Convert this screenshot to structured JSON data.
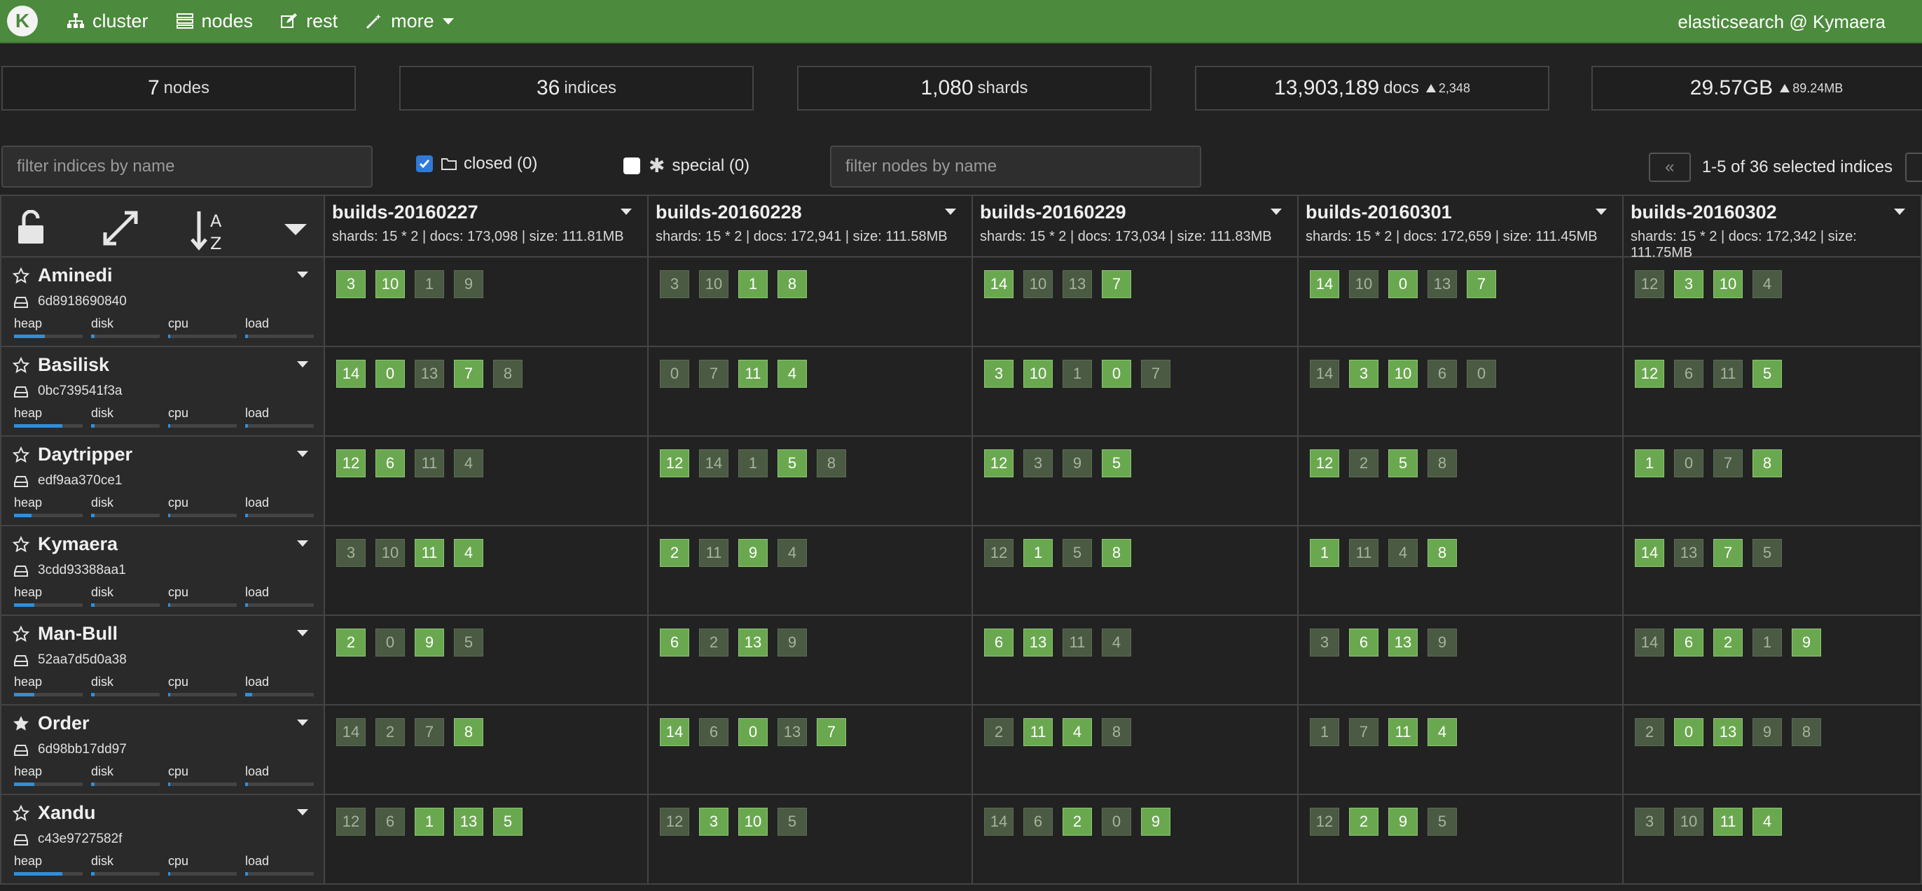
{
  "nav": {
    "logo": "K",
    "items": [
      {
        "label": "cluster",
        "icon": "sitemap-icon"
      },
      {
        "label": "nodes",
        "icon": "server-icon"
      },
      {
        "label": "rest",
        "icon": "edit-icon"
      },
      {
        "label": "more",
        "icon": "magic-icon"
      }
    ],
    "cluster_name": "elasticsearch @ Kymaera"
  },
  "stats": {
    "nodes": {
      "value": "7",
      "unit": "nodes"
    },
    "indices": {
      "value": "36",
      "unit": "indices"
    },
    "shards": {
      "value": "1,080",
      "unit": "shards"
    },
    "docs": {
      "value": "13,903,189",
      "unit": "docs",
      "delta": "2,348"
    },
    "size": {
      "value": "29.57GB",
      "delta": "89.24MB"
    }
  },
  "filters": {
    "indices_placeholder": "filter indices by name",
    "closed_label": "closed (0)",
    "special_label": "special (0)",
    "nodes_placeholder": "filter nodes by name",
    "pager_prev": "«",
    "pager_text": "1-5 of 36 selected indices"
  },
  "metric_labels": {
    "heap": "heap",
    "disk": "disk",
    "cpu": "cpu",
    "load": "load"
  },
  "indices": [
    {
      "name": "builds-20160227",
      "meta": "shards: 15 * 2 | docs: 173,098 | size: 111.81MB"
    },
    {
      "name": "builds-20160228",
      "meta": "shards: 15 * 2 | docs: 172,941 | size: 111.58MB"
    },
    {
      "name": "builds-20160229",
      "meta": "shards: 15 * 2 | docs: 173,034 | size: 111.83MB"
    },
    {
      "name": "builds-20160301",
      "meta": "shards: 15 * 2 | docs: 172,659 | size: 111.45MB"
    },
    {
      "name": "builds-20160302",
      "meta": "shards: 15 * 2 | docs: 172,342 | size: 111.75MB"
    }
  ],
  "nodes": [
    {
      "name": "Aminedi",
      "id": "6d8918690840",
      "master": false,
      "heap": 0.45,
      "disk": 0.05,
      "cpu": 0.03,
      "load": 0.04,
      "shards": [
        [
          {
            "n": "3",
            "p": true
          },
          {
            "n": "10",
            "p": true
          },
          {
            "n": "1",
            "p": false
          },
          {
            "n": "9",
            "p": false
          }
        ],
        [
          {
            "n": "3",
            "p": false
          },
          {
            "n": "10",
            "p": false
          },
          {
            "n": "1",
            "p": true
          },
          {
            "n": "8",
            "p": true
          }
        ],
        [
          {
            "n": "14",
            "p": true
          },
          {
            "n": "10",
            "p": false
          },
          {
            "n": "13",
            "p": false
          },
          {
            "n": "7",
            "p": true
          }
        ],
        [
          {
            "n": "14",
            "p": true
          },
          {
            "n": "10",
            "p": false
          },
          {
            "n": "0",
            "p": true
          },
          {
            "n": "13",
            "p": false
          },
          {
            "n": "7",
            "p": true
          }
        ],
        [
          {
            "n": "12",
            "p": false
          },
          {
            "n": "3",
            "p": true
          },
          {
            "n": "10",
            "p": true
          },
          {
            "n": "4",
            "p": false
          }
        ]
      ]
    },
    {
      "name": "Basilisk",
      "id": "0bc739541f3a",
      "master": false,
      "heap": 0.7,
      "disk": 0.05,
      "cpu": 0.03,
      "load": 0.04,
      "shards": [
        [
          {
            "n": "14",
            "p": true
          },
          {
            "n": "0",
            "p": true
          },
          {
            "n": "13",
            "p": false
          },
          {
            "n": "7",
            "p": true
          },
          {
            "n": "8",
            "p": false
          }
        ],
        [
          {
            "n": "0",
            "p": false
          },
          {
            "n": "7",
            "p": false
          },
          {
            "n": "11",
            "p": true
          },
          {
            "n": "4",
            "p": true
          }
        ],
        [
          {
            "n": "3",
            "p": true
          },
          {
            "n": "10",
            "p": true
          },
          {
            "n": "1",
            "p": false
          },
          {
            "n": "0",
            "p": true
          },
          {
            "n": "7",
            "p": false
          }
        ],
        [
          {
            "n": "14",
            "p": false
          },
          {
            "n": "3",
            "p": true
          },
          {
            "n": "10",
            "p": true
          },
          {
            "n": "6",
            "p": false
          },
          {
            "n": "0",
            "p": false
          }
        ],
        [
          {
            "n": "12",
            "p": true
          },
          {
            "n": "6",
            "p": false
          },
          {
            "n": "11",
            "p": false
          },
          {
            "n": "5",
            "p": true
          }
        ]
      ]
    },
    {
      "name": "Daytripper",
      "id": "edf9aa370ce1",
      "master": false,
      "heap": 0.25,
      "disk": 0.05,
      "cpu": 0.03,
      "load": 0.04,
      "shards": [
        [
          {
            "n": "12",
            "p": true
          },
          {
            "n": "6",
            "p": true
          },
          {
            "n": "11",
            "p": false
          },
          {
            "n": "4",
            "p": false
          }
        ],
        [
          {
            "n": "12",
            "p": true
          },
          {
            "n": "14",
            "p": false
          },
          {
            "n": "1",
            "p": false
          },
          {
            "n": "5",
            "p": true
          },
          {
            "n": "8",
            "p": false
          }
        ],
        [
          {
            "n": "12",
            "p": true
          },
          {
            "n": "3",
            "p": false
          },
          {
            "n": "9",
            "p": false
          },
          {
            "n": "5",
            "p": true
          }
        ],
        [
          {
            "n": "12",
            "p": true
          },
          {
            "n": "2",
            "p": false
          },
          {
            "n": "5",
            "p": true
          },
          {
            "n": "8",
            "p": false
          }
        ],
        [
          {
            "n": "1",
            "p": true
          },
          {
            "n": "0",
            "p": false
          },
          {
            "n": "7",
            "p": false
          },
          {
            "n": "8",
            "p": true
          }
        ]
      ]
    },
    {
      "name": "Kymaera",
      "id": "3cdd93388aa1",
      "master": false,
      "heap": 0.3,
      "disk": 0.05,
      "cpu": 0.03,
      "load": 0.04,
      "shards": [
        [
          {
            "n": "3",
            "p": false
          },
          {
            "n": "10",
            "p": false
          },
          {
            "n": "11",
            "p": true
          },
          {
            "n": "4",
            "p": true
          }
        ],
        [
          {
            "n": "2",
            "p": true
          },
          {
            "n": "11",
            "p": false
          },
          {
            "n": "9",
            "p": true
          },
          {
            "n": "4",
            "p": false
          }
        ],
        [
          {
            "n": "12",
            "p": false
          },
          {
            "n": "1",
            "p": true
          },
          {
            "n": "5",
            "p": false
          },
          {
            "n": "8",
            "p": true
          }
        ],
        [
          {
            "n": "1",
            "p": true
          },
          {
            "n": "11",
            "p": false
          },
          {
            "n": "4",
            "p": false
          },
          {
            "n": "8",
            "p": true
          }
        ],
        [
          {
            "n": "14",
            "p": true
          },
          {
            "n": "13",
            "p": false
          },
          {
            "n": "7",
            "p": true
          },
          {
            "n": "5",
            "p": false
          }
        ]
      ]
    },
    {
      "name": "Man-Bull",
      "id": "52aa7d5d0a38",
      "master": false,
      "heap": 0.3,
      "disk": 0.05,
      "cpu": 0.03,
      "load": 0.1,
      "shards": [
        [
          {
            "n": "2",
            "p": true
          },
          {
            "n": "0",
            "p": false
          },
          {
            "n": "9",
            "p": true
          },
          {
            "n": "5",
            "p": false
          }
        ],
        [
          {
            "n": "6",
            "p": true
          },
          {
            "n": "2",
            "p": false
          },
          {
            "n": "13",
            "p": true
          },
          {
            "n": "9",
            "p": false
          }
        ],
        [
          {
            "n": "6",
            "p": true
          },
          {
            "n": "13",
            "p": true
          },
          {
            "n": "11",
            "p": false
          },
          {
            "n": "4",
            "p": false
          }
        ],
        [
          {
            "n": "3",
            "p": false
          },
          {
            "n": "6",
            "p": true
          },
          {
            "n": "13",
            "p": true
          },
          {
            "n": "9",
            "p": false
          }
        ],
        [
          {
            "n": "14",
            "p": false
          },
          {
            "n": "6",
            "p": true
          },
          {
            "n": "2",
            "p": true
          },
          {
            "n": "1",
            "p": false
          },
          {
            "n": "9",
            "p": true
          }
        ]
      ]
    },
    {
      "name": "Order",
      "id": "6d98bb17dd97",
      "master": true,
      "heap": 0.3,
      "disk": 0.05,
      "cpu": 0.03,
      "load": 0.04,
      "shards": [
        [
          {
            "n": "14",
            "p": false
          },
          {
            "n": "2",
            "p": false
          },
          {
            "n": "7",
            "p": false
          },
          {
            "n": "8",
            "p": true
          }
        ],
        [
          {
            "n": "14",
            "p": true
          },
          {
            "n": "6",
            "p": false
          },
          {
            "n": "0",
            "p": true
          },
          {
            "n": "13",
            "p": false
          },
          {
            "n": "7",
            "p": true
          }
        ],
        [
          {
            "n": "2",
            "p": false
          },
          {
            "n": "11",
            "p": true
          },
          {
            "n": "4",
            "p": true
          },
          {
            "n": "8",
            "p": false
          }
        ],
        [
          {
            "n": "1",
            "p": false
          },
          {
            "n": "7",
            "p": false
          },
          {
            "n": "11",
            "p": true
          },
          {
            "n": "4",
            "p": true
          }
        ],
        [
          {
            "n": "2",
            "p": false
          },
          {
            "n": "0",
            "p": true
          },
          {
            "n": "13",
            "p": true
          },
          {
            "n": "9",
            "p": false
          },
          {
            "n": "8",
            "p": false
          }
        ]
      ]
    },
    {
      "name": "Xandu",
      "id": "c43e9727582f",
      "master": false,
      "heap": 0.7,
      "disk": 0.05,
      "cpu": 0.03,
      "load": 0.04,
      "shards": [
        [
          {
            "n": "12",
            "p": false
          },
          {
            "n": "6",
            "p": false
          },
          {
            "n": "1",
            "p": true
          },
          {
            "n": "13",
            "p": true
          },
          {
            "n": "5",
            "p": true
          }
        ],
        [
          {
            "n": "12",
            "p": false
          },
          {
            "n": "3",
            "p": true
          },
          {
            "n": "10",
            "p": true
          },
          {
            "n": "5",
            "p": false
          }
        ],
        [
          {
            "n": "14",
            "p": false
          },
          {
            "n": "6",
            "p": false
          },
          {
            "n": "2",
            "p": true
          },
          {
            "n": "0",
            "p": false
          },
          {
            "n": "9",
            "p": true
          }
        ],
        [
          {
            "n": "12",
            "p": false
          },
          {
            "n": "2",
            "p": true
          },
          {
            "n": "9",
            "p": true
          },
          {
            "n": "5",
            "p": false
          }
        ],
        [
          {
            "n": "3",
            "p": false
          },
          {
            "n": "10",
            "p": false
          },
          {
            "n": "11",
            "p": true
          },
          {
            "n": "4",
            "p": true
          }
        ]
      ]
    }
  ]
}
